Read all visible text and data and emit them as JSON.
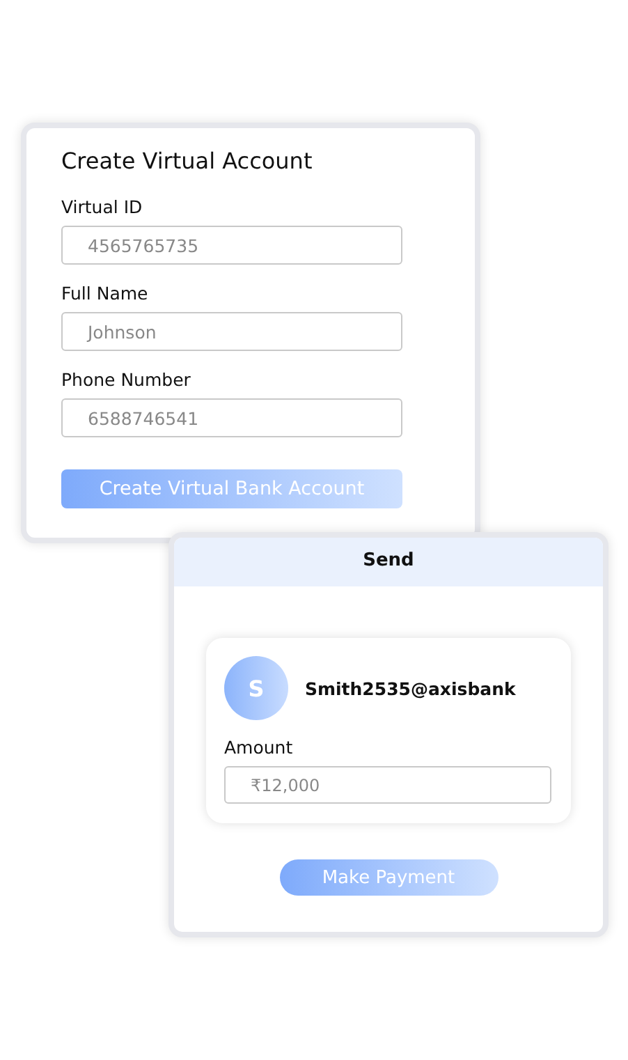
{
  "create_account": {
    "title": "Create Virtual Account",
    "fields": [
      {
        "label": "Virtual ID",
        "placeholder": "4565765735"
      },
      {
        "label": "Full Name",
        "placeholder": "Johnson"
      },
      {
        "label": "Phone Number",
        "placeholder": "6588746541"
      }
    ],
    "button": "Create Virtual Bank Account"
  },
  "send": {
    "title": "Send",
    "avatar_letter": "S",
    "recipient": "Smith2535@axisbank",
    "amount_label": "Amount",
    "amount_placeholder": "₹12,000",
    "button": "Make Payment"
  }
}
